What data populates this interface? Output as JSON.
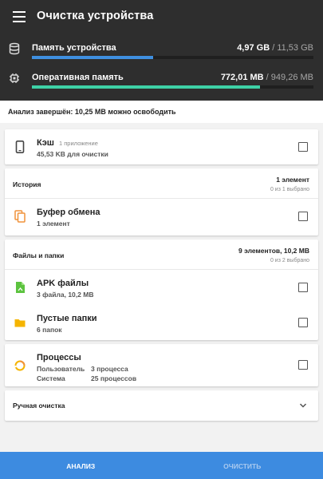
{
  "header": {
    "title": "Очистка устройства",
    "storage": {
      "label": "Память устройства",
      "used": "4,97 GB",
      "sep": " / ",
      "total": "11,53 GB",
      "fraction": 0.43,
      "color": "#3f8fe0",
      "icon": "database-icon"
    },
    "ram": {
      "label": "Оперативная память",
      "used": "772,01 MB",
      "sep": " / ",
      "total": "949,26 MB",
      "fraction": 0.81,
      "color": "#3ed1a6",
      "icon": "chip-icon"
    }
  },
  "status": "Анализ завершён: 10,25 MB можно освободить",
  "cache": {
    "title": "Кэш",
    "inline": "1 приложение",
    "subtitle": "45,53 KB для очистки",
    "icon": "phone-icon"
  },
  "history": {
    "title": "История",
    "count": "1 элемент",
    "selected": "0 из 1 выбрано",
    "items": [
      {
        "title": "Буфер обмена",
        "subtitle": "1 элемент",
        "icon": "clipboard-icon",
        "color": "#f0923a"
      }
    ]
  },
  "files": {
    "title": "Файлы и папки",
    "count": "9 элементов, 10,2 MB",
    "selected": "0 из 2 выбрано",
    "items": [
      {
        "title": "APK файлы",
        "subtitle": "3 файла, 10,2 MB",
        "icon": "apk-file-icon",
        "color": "#5cc33f"
      },
      {
        "title": "Пустые папки",
        "subtitle": "6 папок",
        "icon": "folder-icon",
        "color": "#f5b400"
      }
    ]
  },
  "processes": {
    "title": "Процессы",
    "rows": [
      {
        "k": "Пользователь",
        "v": "3 процесса"
      },
      {
        "k": "Система",
        "v": "25 процессов"
      }
    ],
    "icon": "processes-ring-icon"
  },
  "manual": {
    "title": "Ручная очистка",
    "icon": "chevron-down-icon"
  },
  "bottom": {
    "analyze": "АНАЛИЗ",
    "clean": "ОЧИСТИТЬ"
  }
}
